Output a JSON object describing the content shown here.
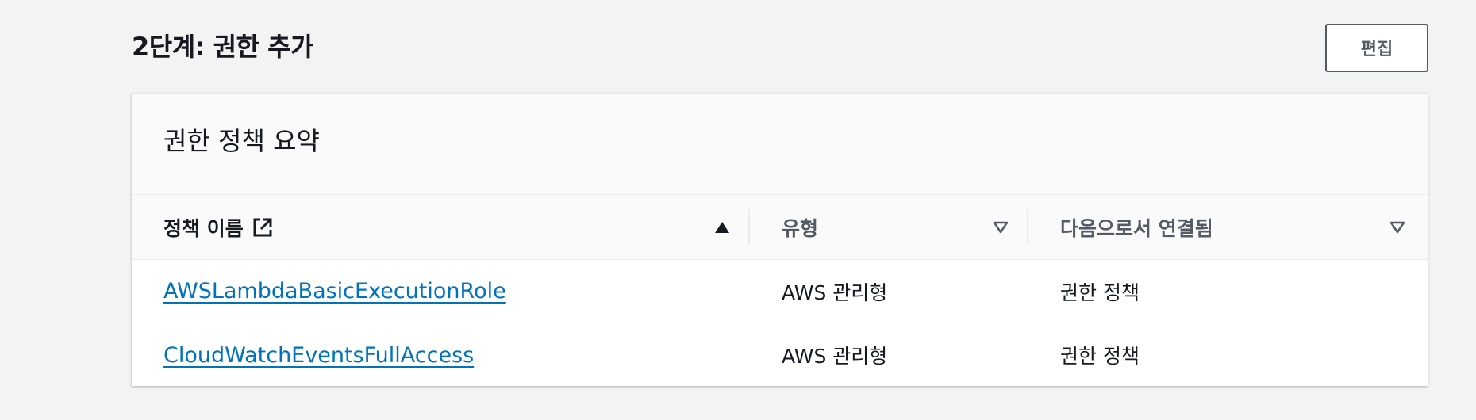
{
  "step": {
    "title": "2단계: 권한 추가",
    "edit_label": "편집"
  },
  "panel": {
    "title": "권한 정책 요약"
  },
  "table": {
    "columns": [
      {
        "label": "정책 이름",
        "sort": "ascending",
        "icon": "external-link-icon"
      },
      {
        "label": "유형",
        "sort": "none"
      },
      {
        "label": "다음으로서 연결됨",
        "sort": "none"
      }
    ],
    "rows": [
      {
        "name": "AWSLambdaBasicExecutionRole",
        "type": "AWS 관리형",
        "attached_as": "권한 정책"
      },
      {
        "name": "CloudWatchEventsFullAccess",
        "type": "AWS 관리형",
        "attached_as": "권한 정책"
      }
    ]
  },
  "colors": {
    "background": "#f2f3f3",
    "link": "#0073bb",
    "text": "#16191f",
    "muted": "#545b64"
  }
}
